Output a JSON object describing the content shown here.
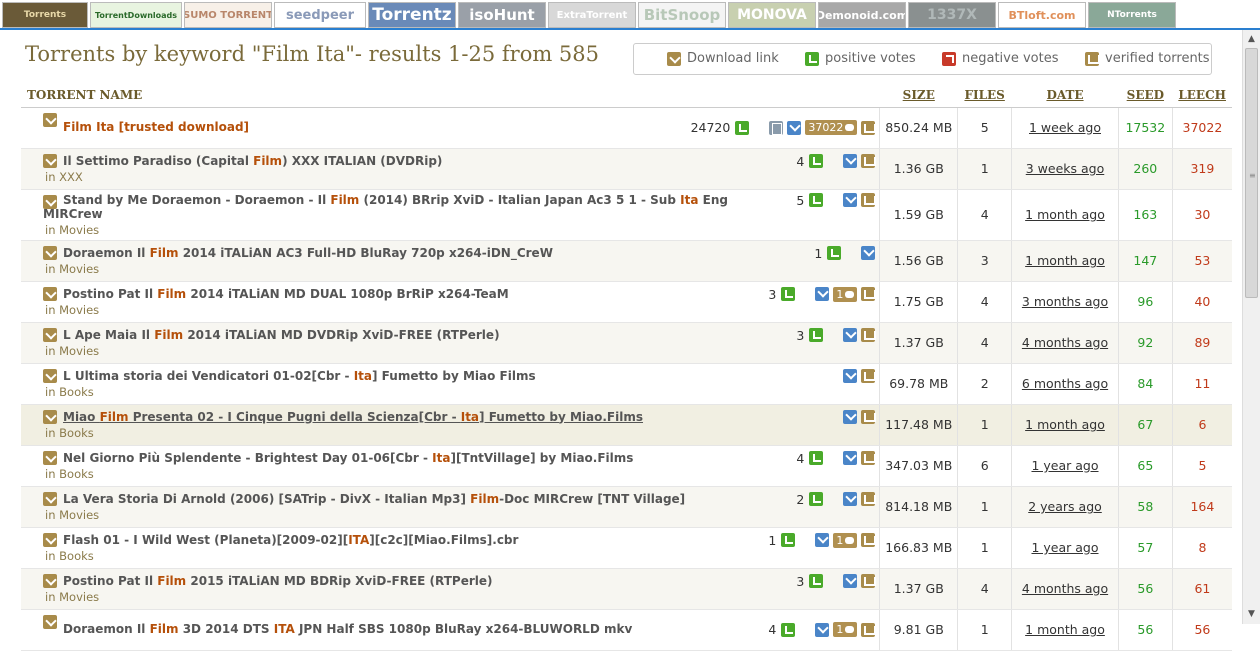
{
  "site_tabs": [
    {
      "label": "Torrents",
      "bg": "#6a5a38",
      "fg": "#e8d8a8"
    },
    {
      "label": "TorrentDownloads",
      "bg": "#e8f4e0",
      "fg": "#2a6a2a"
    },
    {
      "label": "SUMO TORRENT",
      "bg": "#f7f0e8",
      "fg": "#b8866a"
    },
    {
      "label": "seedpeer",
      "bg": "#ffffff",
      "fg": "#8a9ab8"
    },
    {
      "label": "Torrentz",
      "bg": "#6a8ab8",
      "fg": "#ffffff"
    },
    {
      "label": "isoHunt",
      "bg": "#9aa0a8",
      "fg": "#ffffff"
    },
    {
      "label": "ExtraTorrent",
      "bg": "#d8d8d8",
      "fg": "#ffffff"
    },
    {
      "label": "BitSnoop",
      "bg": "#f4f4f4",
      "fg": "#b8c8b8"
    },
    {
      "label": "MONOVA",
      "bg": "#c8d0b0",
      "fg": "#ffffff"
    },
    {
      "label": "Demonoid.com",
      "bg": "#a8a8a8",
      "fg": "#ffffff"
    },
    {
      "label": "1337X",
      "bg": "#8a9090",
      "fg": "#b0b8b8"
    },
    {
      "label": "BTloft.com",
      "bg": "#ffffff",
      "fg": "#e0905a"
    },
    {
      "label": "NTorrents",
      "bg": "#8aa898",
      "fg": "#ffffff"
    }
  ],
  "page_title": "Torrents by keyword \"Film Ita\"- results 1-25 from 585",
  "legend": {
    "download": "Download link",
    "positive": "positive votes",
    "negative": "negative votes",
    "verified": "verified torrents"
  },
  "table": {
    "headers": {
      "name": "TORRENT NAME",
      "size": "SIZE",
      "files": "FILES",
      "date": "DATE",
      "seed": "SEED",
      "leech": "LEECH"
    },
    "rows": [
      {
        "parts": [
          {
            "t": "Film Ita [trusted download]",
            "k": true
          }
        ],
        "trusted": true,
        "category": "",
        "votes": "24720",
        "file_icon": true,
        "dl": true,
        "comments": "37022",
        "verified": true,
        "size": "850.24 MB",
        "files": "5",
        "date": "1 week ago",
        "seed": "17532",
        "leech": "37022"
      },
      {
        "parts": [
          {
            "t": "Il Settimo Paradiso (Capital "
          },
          {
            "t": "Film",
            "k": true
          },
          {
            "t": ") XXX ITALIAN (DVDRip)"
          }
        ],
        "category": "in XXX",
        "votes": "4",
        "dl": true,
        "comments": "",
        "verified": true,
        "size": "1.36 GB",
        "files": "1",
        "date": "3 weeks ago",
        "seed": "260",
        "leech": "319"
      },
      {
        "parts": [
          {
            "t": "Stand by Me Doraemon - Doraemon - Il "
          },
          {
            "t": "Film",
            "k": true
          },
          {
            "t": " (2014) BRrip XviD - Italian Japan Ac3 5 1 - Sub "
          },
          {
            "t": "Ita",
            "k": true
          },
          {
            "t": " Eng MIRCrew"
          }
        ],
        "category": "in Movies",
        "votes": "5",
        "dl": true,
        "comments": "",
        "verified": true,
        "size": "1.59 GB",
        "files": "4",
        "date": "1 month ago",
        "seed": "163",
        "leech": "30"
      },
      {
        "parts": [
          {
            "t": "Doraemon Il "
          },
          {
            "t": "Film",
            "k": true
          },
          {
            "t": " 2014 iTALiAN AC3 Full-HD BluRay 720p x264-iDN_CreW"
          }
        ],
        "category": "in Movies",
        "votes": "1",
        "dl": true,
        "comments": "",
        "verified": false,
        "size": "1.56 GB",
        "files": "3",
        "date": "1 month ago",
        "seed": "147",
        "leech": "53"
      },
      {
        "parts": [
          {
            "t": "Postino Pat Il "
          },
          {
            "t": "Film",
            "k": true
          },
          {
            "t": " 2014 iTALiAN MD DUAL 1080p BrRiP x264-TeaM"
          }
        ],
        "category": "in Movies",
        "votes": "3",
        "dl": true,
        "comments": "1",
        "verified": true,
        "size": "1.75 GB",
        "files": "4",
        "date": "3 months ago",
        "seed": "96",
        "leech": "40"
      },
      {
        "parts": [
          {
            "t": "L Ape Maia Il "
          },
          {
            "t": "Film",
            "k": true
          },
          {
            "t": " 2014 iTALiAN MD DVDRip XviD-FREE (RTPerle)"
          }
        ],
        "category": "in Movies",
        "votes": "3",
        "dl": true,
        "comments": "",
        "verified": true,
        "size": "1.37 GB",
        "files": "4",
        "date": "4 months ago",
        "seed": "92",
        "leech": "89"
      },
      {
        "parts": [
          {
            "t": "L Ultima storia dei Vendicatori 01-02[Cbr - "
          },
          {
            "t": "Ita",
            "k": true
          },
          {
            "t": "] Fumetto by Miao Films"
          }
        ],
        "category": "in Books",
        "votes": "",
        "dl": true,
        "comments": "",
        "verified": true,
        "size": "69.78 MB",
        "files": "2",
        "date": "6 months ago",
        "seed": "84",
        "leech": "11"
      },
      {
        "parts": [
          {
            "t": "Miao "
          },
          {
            "t": "Film",
            "k": true
          },
          {
            "t": " Presenta 02 - I Cinque Pugni della Scienza[Cbr - "
          },
          {
            "t": "Ita",
            "k": true
          },
          {
            "t": "] Fumetto by Miao.Films"
          }
        ],
        "category": "in Books",
        "votes": "",
        "dl": true,
        "comments": "",
        "verified": true,
        "size": "117.48 MB",
        "files": "1",
        "date": "1 month ago",
        "seed": "67",
        "leech": "6",
        "hover": true
      },
      {
        "parts": [
          {
            "t": "Nel Giorno Più Splendente - Brightest Day 01-06[Cbr - "
          },
          {
            "t": "Ita",
            "k": true
          },
          {
            "t": "][TntVillage] by Miao.Films"
          }
        ],
        "category": "in Books",
        "votes": "4",
        "dl": true,
        "comments": "",
        "verified": true,
        "size": "347.03 MB",
        "files": "6",
        "date": "1 year ago",
        "seed": "65",
        "leech": "5"
      },
      {
        "parts": [
          {
            "t": "La Vera Storia Di Arnold (2006) [SATrip - DivX - Italian Mp3] "
          },
          {
            "t": "Film",
            "k": true
          },
          {
            "t": "-Doc MIRCrew [TNT Village]"
          }
        ],
        "category": "in Movies",
        "votes": "2",
        "dl": true,
        "comments": "",
        "verified": true,
        "size": "814.18 MB",
        "files": "1",
        "date": "2 years ago",
        "seed": "58",
        "leech": "164"
      },
      {
        "parts": [
          {
            "t": "Flash 01 - I Wild West (Planeta)[2009-02]["
          },
          {
            "t": "ITA",
            "k": true
          },
          {
            "t": "][c2c][Miao.Films].cbr"
          }
        ],
        "category": "in Books",
        "votes": "1",
        "dl": true,
        "comments": "1",
        "verified": true,
        "size": "166.83 MB",
        "files": "1",
        "date": "1 year ago",
        "seed": "57",
        "leech": "8"
      },
      {
        "parts": [
          {
            "t": "Postino Pat Il "
          },
          {
            "t": "Film",
            "k": true
          },
          {
            "t": " 2015 iTALiAN MD BDRip XviD-FREE (RTPerle)"
          }
        ],
        "category": "in Movies",
        "votes": "3",
        "dl": true,
        "comments": "",
        "verified": true,
        "size": "1.37 GB",
        "files": "4",
        "date": "4 months ago",
        "seed": "56",
        "leech": "61"
      },
      {
        "parts": [
          {
            "t": "Doraemon Il "
          },
          {
            "t": "Film",
            "k": true
          },
          {
            "t": " 3D 2014 DTS "
          },
          {
            "t": "ITA",
            "k": true
          },
          {
            "t": " JPN Half SBS 1080p BluRay x264-BLUWORLD mkv"
          }
        ],
        "category": "",
        "votes": "4",
        "dl": true,
        "comments": "1",
        "verified": true,
        "size": "9.81 GB",
        "files": "1",
        "date": "1 month ago",
        "seed": "56",
        "leech": "56"
      }
    ]
  }
}
